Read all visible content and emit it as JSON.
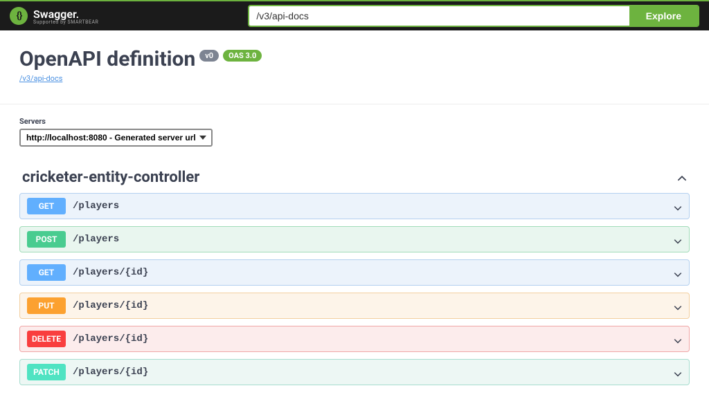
{
  "topbar": {
    "brand": "Swagger.",
    "brand_sub": "Supported by SMARTBEAR",
    "url_value": "/v3/api-docs",
    "explore_label": "Explore"
  },
  "header": {
    "title": "OpenAPI definition",
    "version_badge": "v0",
    "oas_badge": "OAS 3.0",
    "spec_link": "/v3/api-docs"
  },
  "servers": {
    "label": "Servers",
    "selected": "http://localhost:8080 - Generated server url"
  },
  "tag": {
    "name": "cricketer-entity-controller",
    "ops": [
      {
        "method": "GET",
        "path": "/players"
      },
      {
        "method": "POST",
        "path": "/players"
      },
      {
        "method": "GET",
        "path": "/players/{id}"
      },
      {
        "method": "PUT",
        "path": "/players/{id}"
      },
      {
        "method": "DELETE",
        "path": "/players/{id}"
      },
      {
        "method": "PATCH",
        "path": "/players/{id}"
      }
    ]
  }
}
